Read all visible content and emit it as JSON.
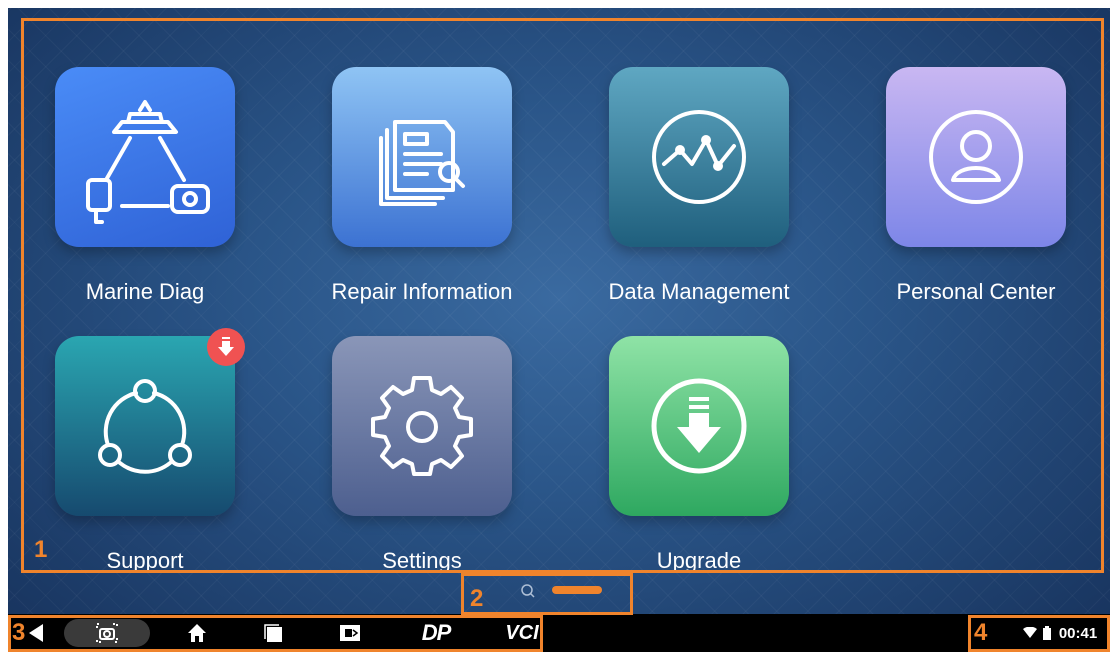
{
  "apps": [
    {
      "id": "marine-diag",
      "label": "Marine Diag",
      "icon": "marine-diag-icon"
    },
    {
      "id": "repair-information",
      "label": "Repair Information",
      "icon": "document-search-icon"
    },
    {
      "id": "data-management",
      "label": "Data Management",
      "icon": "line-chart-icon"
    },
    {
      "id": "personal-center",
      "label": "Personal Center",
      "icon": "user-icon"
    },
    {
      "id": "support",
      "label": "Support",
      "icon": "share-network-icon",
      "badge": "download-badge-icon"
    },
    {
      "id": "settings",
      "label": "Settings",
      "icon": "gear-icon"
    },
    {
      "id": "upgrade",
      "label": "Upgrade",
      "icon": "download-icon"
    }
  ],
  "callouts": [
    "1",
    "2",
    "3",
    "4"
  ],
  "navbar": {
    "items": [
      "back-icon",
      "screenshot-icon",
      "home-icon",
      "recent-apps-icon",
      "display-icon",
      "dp-logo-icon",
      "vci-logo-icon"
    ],
    "dp_label": "DP",
    "vci_label": "VCI"
  },
  "status": {
    "time": "00:41",
    "icons": [
      "wifi-icon",
      "battery-icon"
    ]
  },
  "colors": {
    "callout": "#f0842c",
    "background": "#2a5588",
    "badge": "#f05252"
  }
}
